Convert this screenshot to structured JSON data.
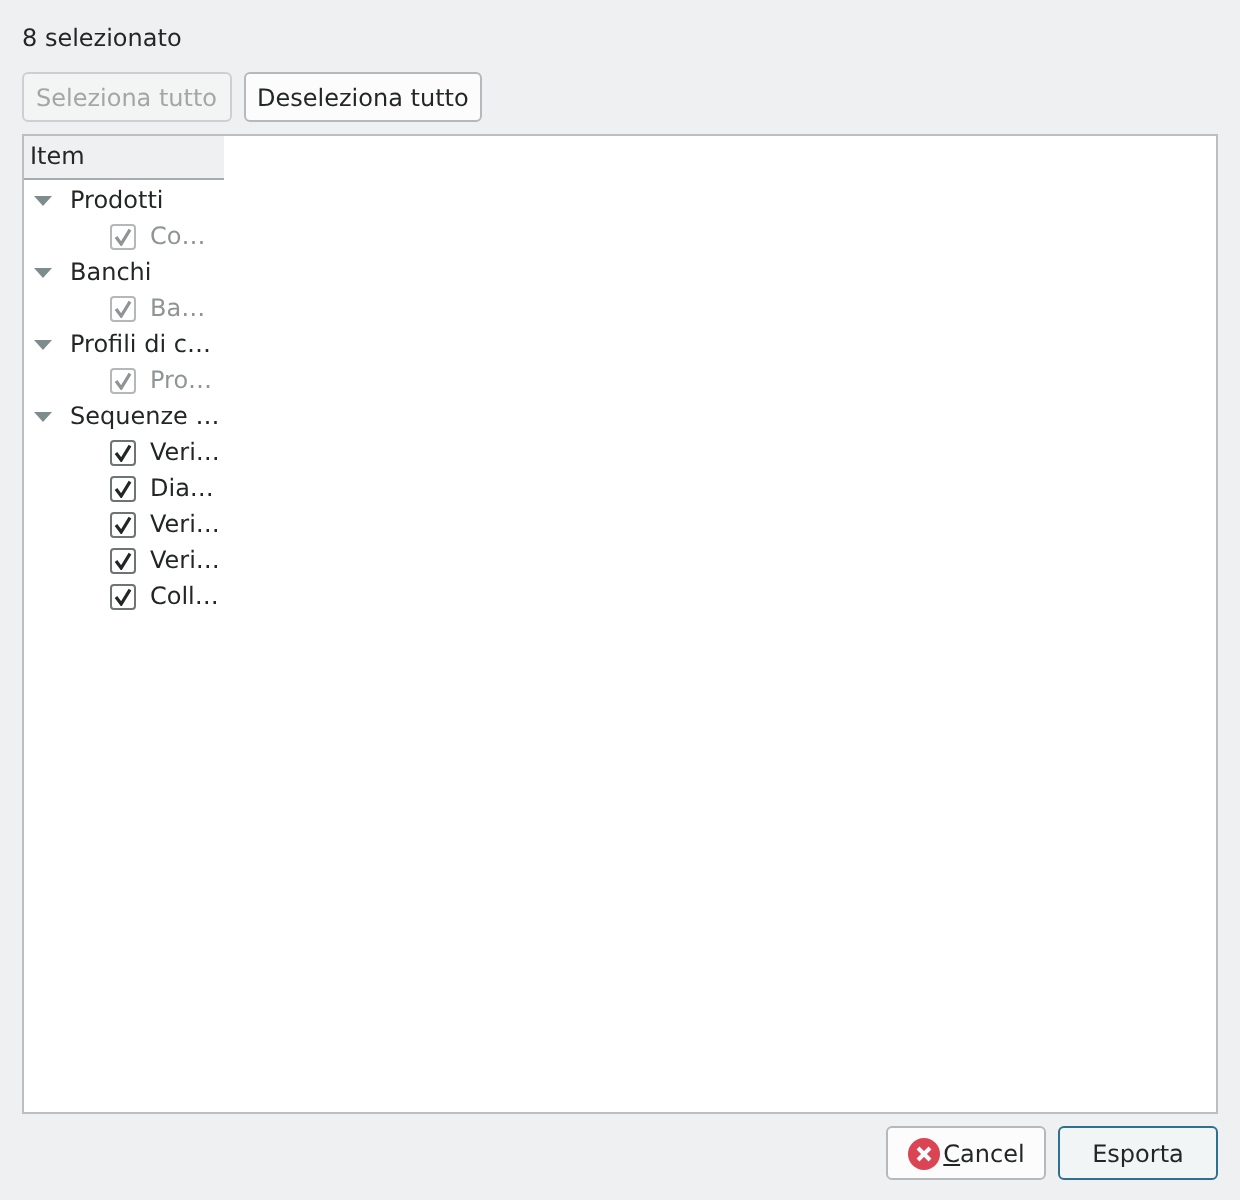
{
  "status": {
    "text": "8 selezionato"
  },
  "toolbar": [
    {
      "label": "Seleziona tutto",
      "disabled": true
    },
    {
      "label": "Deseleziona tutto",
      "disabled": false
    }
  ],
  "tree": {
    "columns": [
      {
        "label": "Item"
      }
    ],
    "items": [
      {
        "label": "Prodotti",
        "expanded": true,
        "children": [
          {
            "label": "Co…",
            "checked": true,
            "disabled": true
          }
        ]
      },
      {
        "label": "Banchi",
        "expanded": true,
        "children": [
          {
            "label": "Ba…",
            "checked": true,
            "disabled": true
          }
        ]
      },
      {
        "label": "Profili di c…",
        "expanded": true,
        "children": [
          {
            "label": "Pro…",
            "checked": true,
            "disabled": true
          }
        ]
      },
      {
        "label": "Sequenze …",
        "expanded": true,
        "children": [
          {
            "label": "Veri…",
            "checked": true,
            "disabled": false
          },
          {
            "label": "Dia…",
            "checked": true,
            "disabled": false
          },
          {
            "label": "Veri…",
            "checked": true,
            "disabled": false
          },
          {
            "label": "Veri…",
            "checked": true,
            "disabled": false
          },
          {
            "label": "Coll…",
            "checked": true,
            "disabled": false
          }
        ]
      }
    ]
  },
  "dialog_buttons": [
    {
      "label": "Cancel",
      "kind": "cancel",
      "mnemonic": true,
      "default": false
    },
    {
      "label": "Esporta",
      "kind": "plain",
      "mnemonic": false,
      "default": true
    }
  ]
}
